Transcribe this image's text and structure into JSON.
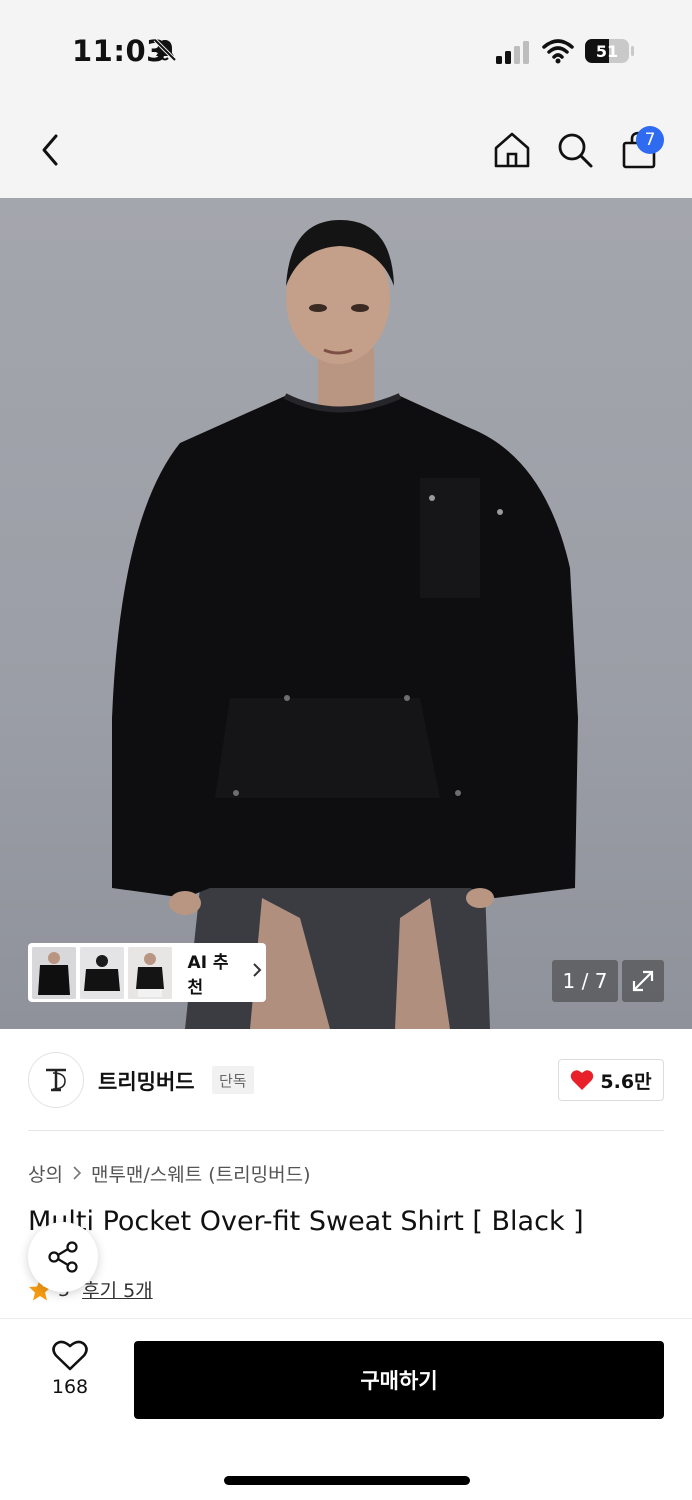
{
  "status_bar": {
    "time": "11:03",
    "battery": "51"
  },
  "nav": {
    "cart_count": "7"
  },
  "gallery": {
    "counter": "1 / 7",
    "ai_label": "AI 추천"
  },
  "brand": {
    "name": "트리밍버드",
    "tag": "단독",
    "likes": "5.6만"
  },
  "breadcrumb": {
    "category": "상의",
    "subcategory": "맨투맨/스웨트 (트리밍버드)"
  },
  "product": {
    "title": "Multi Pocket Over-fit Sweat Shirt [ Black ]",
    "rating": "5",
    "reviews": "후기 5개"
  },
  "bottom": {
    "wish_count": "168",
    "buy_label": "구매하기"
  },
  "colors": {
    "accent": "#2f6bf0",
    "heart": "#e8202a",
    "star": "#f59a12"
  }
}
